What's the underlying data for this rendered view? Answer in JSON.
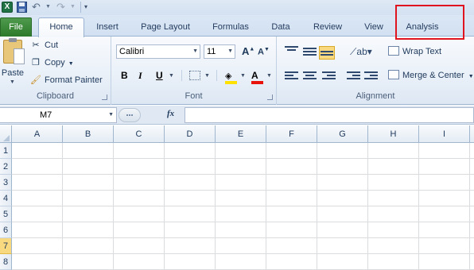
{
  "quick_access": {
    "app_icon_text": "X",
    "icons": [
      "excel-icon",
      "save-icon",
      "undo-icon",
      "redo-icon",
      "customize-icon"
    ]
  },
  "tabs": [
    {
      "label": "File",
      "active": false
    },
    {
      "label": "Home",
      "active": true
    },
    {
      "label": "Insert",
      "active": false
    },
    {
      "label": "Page Layout",
      "active": false
    },
    {
      "label": "Formulas",
      "active": false
    },
    {
      "label": "Data",
      "active": false
    },
    {
      "label": "Review",
      "active": false
    },
    {
      "label": "View",
      "active": false
    },
    {
      "label": "Analysis",
      "active": false,
      "highlighted": true
    }
  ],
  "highlight_color": "#e0141e",
  "clipboard": {
    "paste_label": "Paste",
    "cut_label": "Cut",
    "copy_label": "Copy",
    "format_painter_label": "Format Painter",
    "group_label": "Clipboard"
  },
  "font": {
    "font_name": "Calibri",
    "font_size": "11",
    "bold_label": "B",
    "italic_label": "I",
    "underline_label": "U",
    "font_color_label": "A",
    "fill_color": "#ffe100",
    "font_color": "#e8140c",
    "group_label": "Font"
  },
  "alignment": {
    "wrap_text_label": "Wrap Text",
    "merge_center_label": "Merge & Center",
    "group_label": "Alignment"
  },
  "formula_bar": {
    "name_box": "M7",
    "fx_label": "fx",
    "formula": ""
  },
  "sheet": {
    "columns": [
      "A",
      "B",
      "C",
      "D",
      "E",
      "F",
      "G",
      "H",
      "I"
    ],
    "rows": [
      "1",
      "2",
      "3",
      "4",
      "5",
      "6",
      "7",
      "8"
    ],
    "active_row": "7"
  }
}
